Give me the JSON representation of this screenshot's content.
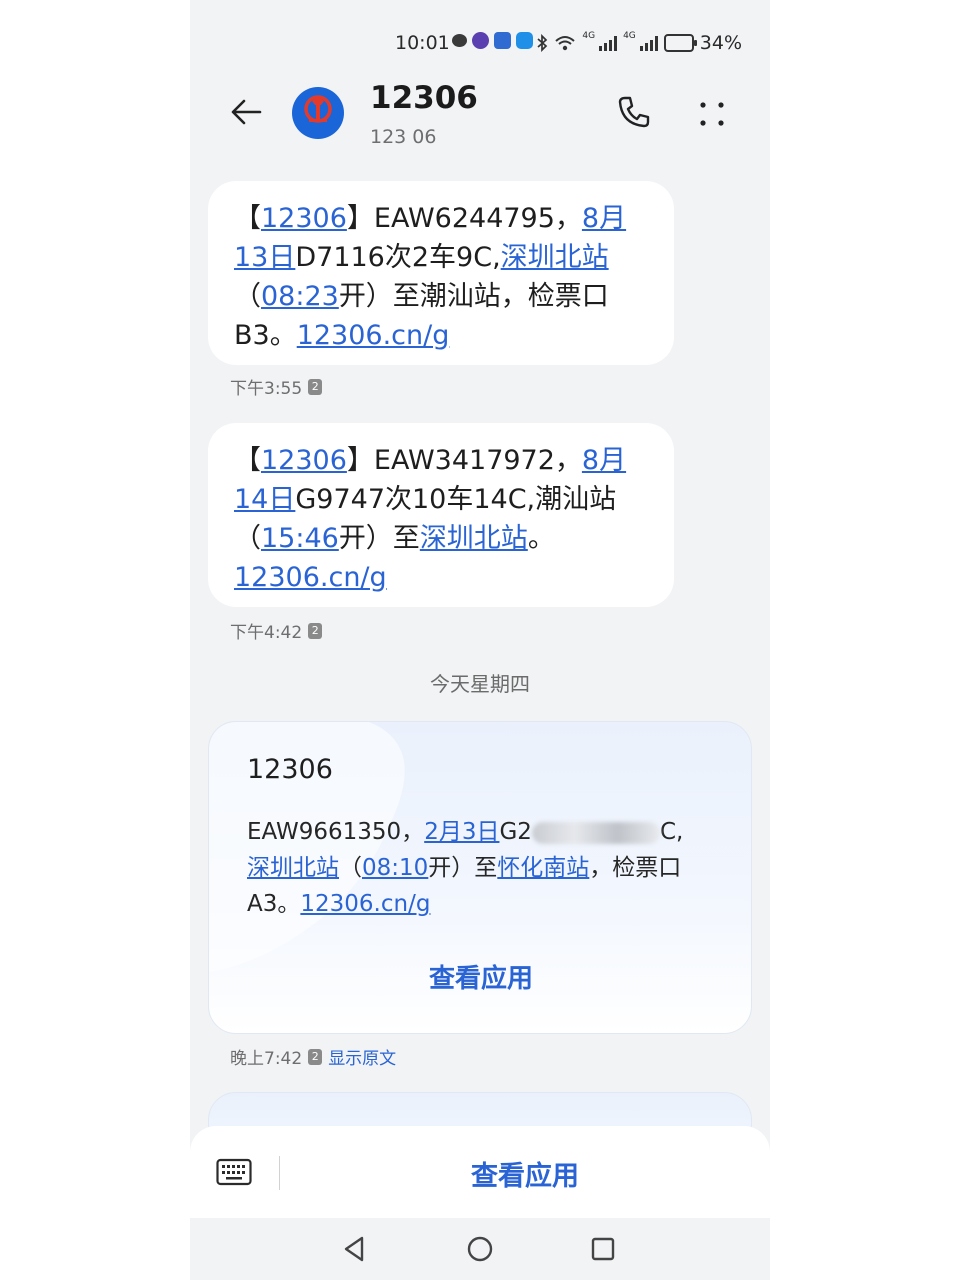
{
  "status_bar": {
    "time": "10:01",
    "notification_icons": [
      "chat-icon",
      "purple-app-icon",
      "car-app-icon",
      "blue-app-icon"
    ],
    "network_tag_1": "4G",
    "network_tag_2": "4G",
    "battery": "34%"
  },
  "header": {
    "title": "12306",
    "subtitle": "123 06",
    "avatar_label": "中国铁路"
  },
  "messages": [
    {
      "segments": [
        {
          "text": "【",
          "link": false
        },
        {
          "text": "12306",
          "link": true
        },
        {
          "text": "】EAW6244795，",
          "link": false
        },
        {
          "text": "8月13日",
          "link": true
        },
        {
          "text": "D7116次2车9C,",
          "link": false
        },
        {
          "text": "深圳北站",
          "link": true
        },
        {
          "text": "（",
          "link": false
        },
        {
          "text": "08:23",
          "link": true
        },
        {
          "text": "开）至潮汕站，检票口B3。",
          "link": false
        },
        {
          "text": "12306.cn/g",
          "link": true
        }
      ],
      "time": "下午3:55",
      "sim": "2"
    },
    {
      "segments": [
        {
          "text": "【",
          "link": false
        },
        {
          "text": "12306",
          "link": true
        },
        {
          "text": "】EAW3417972，",
          "link": false
        },
        {
          "text": "8月14日",
          "link": true
        },
        {
          "text": "G9747次10车14C,潮汕站（",
          "link": false
        },
        {
          "text": "15:46",
          "link": true
        },
        {
          "text": "开）至",
          "link": false
        },
        {
          "text": "深圳北站",
          "link": true
        },
        {
          "text": "。",
          "link": false
        },
        {
          "text": "12306.cn/g",
          "link": true
        }
      ],
      "time": "下午4:42",
      "sim": "2"
    }
  ],
  "day_separator": "今天星期四",
  "card": {
    "title": "12306",
    "text_before_link": "EAW9661350，",
    "date_link": "2月3日",
    "train_prefix": "G2",
    "after_blur": "C,",
    "station_from": "深圳北站",
    "paren_open": "（",
    "time_link": "08:10",
    "mid_text": "开）至",
    "station_to": "怀化南站",
    "tail_text": "，检票口A3。",
    "url": "12306.cn/g",
    "action_label": "查看应用",
    "time": "晚上7:42",
    "sim": "2",
    "show_original": "显示原文"
  },
  "bottom_bar": {
    "action_label": "查看应用"
  },
  "colors": {
    "link": "#2a64d4",
    "bubble": "#ffffff",
    "background": "#f1f3f5",
    "avatar": "#1a66d8"
  }
}
